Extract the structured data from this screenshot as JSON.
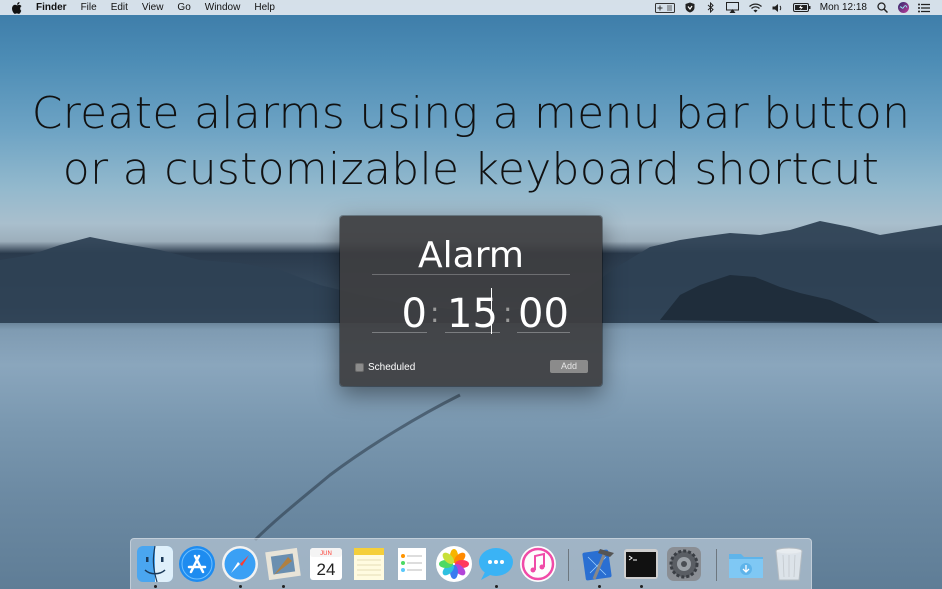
{
  "menubar": {
    "app_name": "Finder",
    "menus": [
      "File",
      "Edit",
      "View",
      "Go",
      "Window",
      "Help"
    ],
    "clock": "Mon 12:18",
    "status_icons": [
      "alarm-plus-icon",
      "shield-icon",
      "bluetooth-icon",
      "airplay-icon",
      "wifi-icon",
      "volume-icon",
      "battery-icon",
      "search-icon",
      "siri-icon",
      "list-icon"
    ]
  },
  "headline": {
    "line1": "Create alarms using a menu bar button",
    "line2": "or a customizable keyboard shortcut"
  },
  "panel": {
    "title": "Alarm",
    "hours": "0",
    "minutes": "15",
    "seconds": "00",
    "separator": ":",
    "scheduled_label": "Scheduled",
    "scheduled_checked": false,
    "add_label": "Add"
  },
  "dock": {
    "apps": [
      "finder-icon",
      "app-store-icon",
      "safari-icon",
      "mail-icon",
      "calendar-icon",
      "notes-icon",
      "reminders-icon",
      "photos-icon",
      "messages-icon",
      "itunes-icon",
      "xcode-icon",
      "terminal-icon",
      "system-preferences-icon",
      "downloads-folder-icon",
      "trash-icon"
    ],
    "calendar_month": "JUN",
    "calendar_day": "24"
  }
}
